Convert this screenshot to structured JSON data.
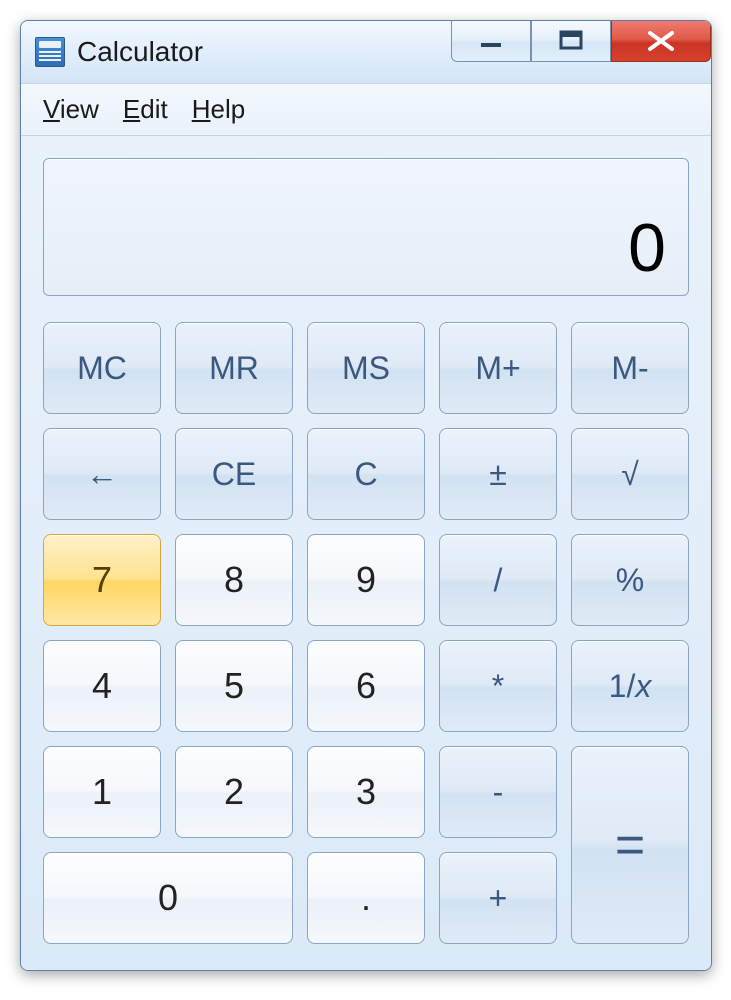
{
  "window": {
    "title": "Calculator"
  },
  "menu": {
    "view": "View",
    "edit": "Edit",
    "help": "Help"
  },
  "display": {
    "value": "0"
  },
  "buttons": {
    "mc": "MC",
    "mr": "MR",
    "ms": "MS",
    "mplus": "M+",
    "mminus": "M-",
    "back": "←",
    "ce": "CE",
    "c": "C",
    "pm": "±",
    "sqrt": "√",
    "n7": "7",
    "n8": "8",
    "n9": "9",
    "div": "/",
    "pct": "%",
    "n4": "4",
    "n5": "5",
    "n6": "6",
    "mul": "*",
    "recip": "1/x",
    "n1": "1",
    "n2": "2",
    "n3": "3",
    "sub": "-",
    "eq": "=",
    "n0": "0",
    "dot": ".",
    "add": "+"
  }
}
